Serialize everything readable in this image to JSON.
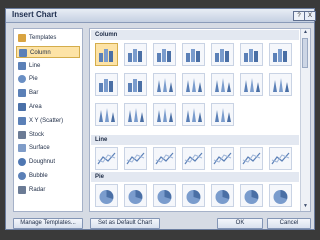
{
  "window": {
    "title": "Insert Chart",
    "help_label": "?",
    "close_label": "X"
  },
  "chart_types": [
    {
      "label": "Templates",
      "icon": "folder-icon"
    },
    {
      "label": "Column",
      "icon": "column-chart-icon"
    },
    {
      "label": "Line",
      "icon": "line-chart-icon"
    },
    {
      "label": "Pie",
      "icon": "pie-chart-icon"
    },
    {
      "label": "Bar",
      "icon": "bar-chart-icon"
    },
    {
      "label": "Area",
      "icon": "area-chart-icon"
    },
    {
      "label": "X Y (Scatter)",
      "icon": "scatter-chart-icon"
    },
    {
      "label": "Stock",
      "icon": "stock-chart-icon"
    },
    {
      "label": "Surface",
      "icon": "surface-chart-icon"
    },
    {
      "label": "Doughnut",
      "icon": "doughnut-chart-icon"
    },
    {
      "label": "Bubble",
      "icon": "bubble-chart-icon"
    },
    {
      "label": "Radar",
      "icon": "radar-chart-icon"
    }
  ],
  "selected_type": "Column",
  "sections": {
    "column": "Column",
    "line": "Line",
    "pie": "Pie"
  },
  "buttons": {
    "manage": "Manage Templates...",
    "default": "Set as Default Chart",
    "ok": "OK",
    "cancel": "Cancel"
  },
  "colors": {
    "accent": "#5b80b7",
    "selection": "#fde3a6"
  }
}
